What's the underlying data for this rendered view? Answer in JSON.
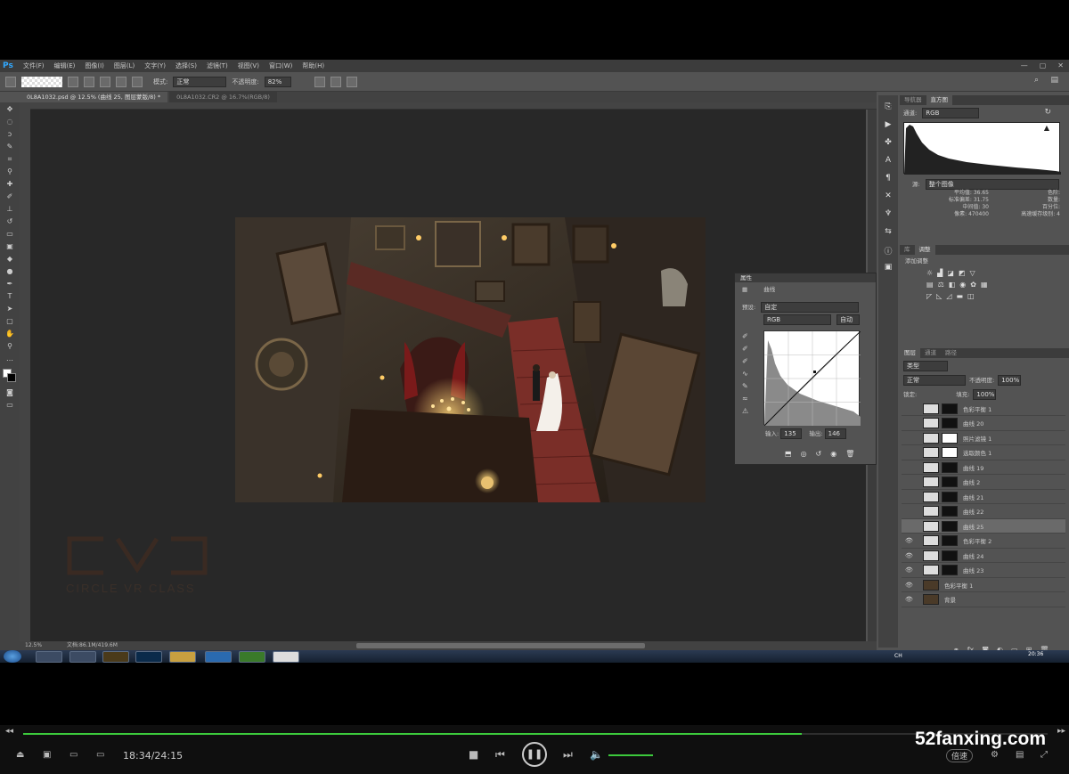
{
  "app": {
    "logo": "Ps",
    "window_buttons": [
      "—",
      "▢",
      "✕"
    ]
  },
  "menu": [
    "文件(F)",
    "编辑(E)",
    "图像(I)",
    "图层(L)",
    "文字(Y)",
    "选择(S)",
    "滤镜(T)",
    "视图(V)",
    "窗口(W)",
    "帮助(H)"
  ],
  "options": {
    "mode_label": "模式:",
    "mode_value": "正常",
    "opacity_label": "不透明度:",
    "opacity_value": "82%"
  },
  "doc_tabs": [
    {
      "label": "0L8A1032.psd @ 12.5% (曲线 25, 图层蒙版/8) *",
      "active": true
    },
    {
      "label": "0L8A1032.CR2 @ 16.7%(RGB/8)",
      "active": false
    }
  ],
  "status": {
    "zoom": "12.5%",
    "doc": "文档:86.1M/419.6M"
  },
  "watermark": {
    "logo_text": "CVC",
    "tagline": "CIRCLE VR CLASS"
  },
  "navigator": {
    "tabs": [
      "导航器",
      "直方图"
    ],
    "channel_label": "通道:",
    "channel_value": "RGB",
    "source_label": "源:",
    "source_value": "整个图像",
    "stats_left": [
      [
        "平均值:",
        "36.65"
      ],
      [
        "标准偏差:",
        "31.75"
      ],
      [
        "中间值:",
        "30"
      ],
      [
        "像素:",
        "470400"
      ]
    ],
    "stats_right": [
      [
        "色阶:",
        ""
      ],
      [
        "数量:",
        ""
      ],
      [
        "百分位:",
        ""
      ],
      [
        "高速缓存级别:",
        "4"
      ]
    ]
  },
  "adjust": {
    "tabs": [
      "库",
      "调整"
    ],
    "title": "添加调整"
  },
  "layers_panel": {
    "tabs": [
      "图层",
      "通道",
      "路径"
    ],
    "kind": "类型",
    "blend": "正常",
    "opacity_label": "不透明度:",
    "opacity": "100%",
    "lock_label": "锁定:",
    "fill_label": "填充:",
    "fill": "100%"
  },
  "layers": [
    {
      "name": "色彩平衡 1",
      "visible": false,
      "selected": false
    },
    {
      "name": "曲线 20",
      "visible": false,
      "selected": false
    },
    {
      "name": "照片滤镜 1",
      "visible": false,
      "selected": false
    },
    {
      "name": "选取颜色 1",
      "visible": false,
      "selected": false
    },
    {
      "name": "曲线 19",
      "visible": false,
      "selected": false
    },
    {
      "name": "曲线 2",
      "visible": false,
      "selected": false
    },
    {
      "name": "曲线 21",
      "visible": false,
      "selected": false
    },
    {
      "name": "曲线 22",
      "visible": false,
      "selected": false
    },
    {
      "name": "曲线 25",
      "visible": false,
      "selected": true
    },
    {
      "name": "色彩平衡 2",
      "visible": true,
      "selected": false
    },
    {
      "name": "曲线 24",
      "visible": true,
      "selected": false
    },
    {
      "name": "曲线 23",
      "visible": true,
      "selected": false
    },
    {
      "name": "色彩平衡 1",
      "visible": true,
      "selected": false
    },
    {
      "name": "背景",
      "visible": true,
      "selected": false
    }
  ],
  "properties": {
    "title": "属性",
    "type": "曲线",
    "preset_label": "预设:",
    "preset": "自定",
    "channel": "RGB",
    "auto": "自动",
    "input_label": "输入:",
    "input": "135",
    "output_label": "输出:",
    "output": "146"
  },
  "taskbar": {
    "clock": "20:36",
    "lang": "CH"
  },
  "player": {
    "time": "18:34/24:15",
    "progress": 0.76,
    "brand": "52fanxing.com",
    "speed": "倍速"
  }
}
